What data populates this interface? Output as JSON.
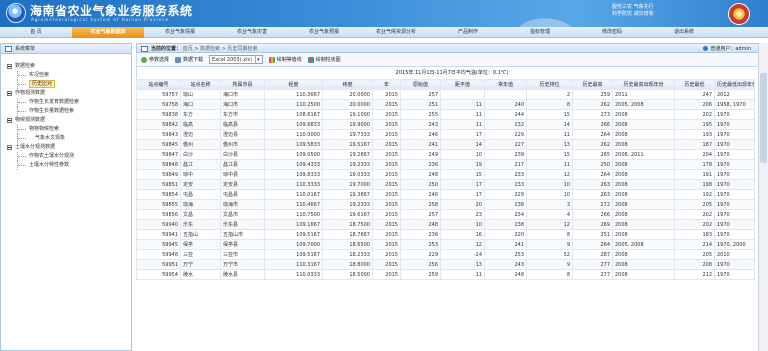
{
  "header": {
    "title": "海南省农业气象业务服务系统",
    "subtitle": "Agrometeorological System of Hainan Province",
    "slogan_line1": "服务三农 气象先行",
    "slogan_line2": "科学防灾 减灾增收"
  },
  "nav": {
    "items": [
      {
        "label": "首 页"
      },
      {
        "label": "农业气象数据库"
      },
      {
        "label": "农业气象情报"
      },
      {
        "label": "农业气象灾害"
      },
      {
        "label": "农业气象预报"
      },
      {
        "label": "农业气候资源分析"
      },
      {
        "label": "产品制作"
      },
      {
        "label": "指标管理"
      },
      {
        "label": "修改密码"
      },
      {
        "label": "退出系统"
      }
    ],
    "active_index": 1
  },
  "sidebar": {
    "title": "系统菜单",
    "tree": [
      {
        "label": "数据检索",
        "level": 0
      },
      {
        "label": "实况检索",
        "level": 1
      },
      {
        "label": "历史比对",
        "level": 1,
        "selected": true
      },
      {
        "label": "作物观测数据",
        "level": 0
      },
      {
        "label": "作物生长发育数据检索",
        "level": 1
      },
      {
        "label": "作物生长量数据检索",
        "level": 1
      },
      {
        "label": "物候观测数据",
        "level": 0
      },
      {
        "label": "物物物候检索",
        "level": 1
      },
      {
        "label": "气象水文现象",
        "level": 1,
        "deep": true
      },
      {
        "label": "土壤水分观测数据",
        "level": 0
      },
      {
        "label": "作物农土壤水分观测",
        "level": 1
      },
      {
        "label": "土壤水分特性参数",
        "level": 1
      }
    ]
  },
  "breadcrumb": {
    "label": "当前的位置：",
    "path": "首页 > 数据检索 > 历史同期检索",
    "user": "普通用户：admin"
  },
  "toolbar": {
    "params_label": "参数选择",
    "download_label": "数据下载",
    "format_value": "Excel 2003(.xls)",
    "line_chart_label": "绘制等值线",
    "bar_chart_label": "绘制柱状图"
  },
  "table": {
    "title": "2015年 11月1日-11月7日平均气温(单位：0.1℃)",
    "columns": [
      "站点编号",
      "站点名称",
      "所属市县",
      "经度",
      "纬度",
      "年",
      "原始值",
      "距平值",
      "常年值",
      "历史排位",
      "历史最高",
      "历史最高出现年份",
      "历史最低",
      "历史最低出现年份"
    ],
    "rows": [
      [
        "59757",
        "琼山",
        "海口市",
        "110.3667",
        "20.0000",
        "2015",
        "257",
        "",
        "",
        "2",
        "259",
        "2011",
        "247",
        "2012"
      ],
      [
        "59758",
        "海口",
        "海口市",
        "110.2500",
        "20.0000",
        "2015",
        "251",
        "11",
        "240",
        "8",
        "262",
        "2005, 2008",
        "206",
        "1958, 1970"
      ],
      [
        "59838",
        "东方",
        "东方市",
        "108.6167",
        "19.1000",
        "2015",
        "255",
        "11",
        "244",
        "15",
        "273",
        "2008",
        "202",
        "1970"
      ],
      [
        "59842",
        "临高",
        "临高县",
        "109.6833",
        "19.9000",
        "2015",
        "243",
        "11",
        "232",
        "14",
        "266",
        "2008",
        "195",
        "1970"
      ],
      [
        "59843",
        "澄迈",
        "澄迈县",
        "110.0000",
        "19.7333",
        "2015",
        "246",
        "17",
        "229",
        "11",
        "264",
        "2008",
        "193",
        "1970"
      ],
      [
        "59845",
        "儋州",
        "儋州市",
        "109.5833",
        "19.5167",
        "2015",
        "241",
        "14",
        "227",
        "13",
        "262",
        "2008",
        "187",
        "1970"
      ],
      [
        "59847",
        "白沙",
        "白沙县",
        "109.0500",
        "19.2667",
        "2015",
        "249",
        "10",
        "239",
        "15",
        "265",
        "2008, 2011",
        "204",
        "1970"
      ],
      [
        "59848",
        "昌江",
        "昌江县",
        "109.4333",
        "19.2333",
        "2015",
        "236",
        "19",
        "217",
        "11",
        "250",
        "2008",
        "178",
        "1970"
      ],
      [
        "59849",
        "琼中",
        "琼中县",
        "109.8333",
        "19.0333",
        "2015",
        "248",
        "15",
        "233",
        "12",
        "264",
        "2008",
        "191",
        "1970"
      ],
      [
        "59851",
        "定安",
        "定安县",
        "110.3333",
        "19.7000",
        "2015",
        "250",
        "17",
        "233",
        "10",
        "263",
        "2008",
        "198",
        "1970"
      ],
      [
        "59854",
        "屯昌",
        "屯昌县",
        "110.0167",
        "19.3667",
        "2015",
        "246",
        "17",
        "229",
        "10",
        "263",
        "2008",
        "192",
        "1970"
      ],
      [
        "59855",
        "琼海",
        "琼海市",
        "110.4667",
        "19.2333",
        "2015",
        "258",
        "20",
        "238",
        "3",
        "272",
        "2008",
        "205",
        "1970"
      ],
      [
        "59856",
        "文昌",
        "文昌市",
        "110.7500",
        "19.6167",
        "2015",
        "257",
        "23",
        "234",
        "4",
        "266",
        "2008",
        "202",
        "1970"
      ],
      [
        "59940",
        "乐东",
        "乐东县",
        "109.1667",
        "18.7500",
        "2015",
        "248",
        "10",
        "238",
        "12",
        "269",
        "2008",
        "202",
        "1970"
      ],
      [
        "59941",
        "五指山",
        "五指山市",
        "109.5167",
        "18.7667",
        "2015",
        "236",
        "16",
        "220",
        "8",
        "251",
        "2008",
        "183",
        "1970"
      ],
      [
        "59945",
        "保亭",
        "保亭县",
        "109.7000",
        "18.6500",
        "2015",
        "253",
        "12",
        "241",
        "9",
        "264",
        "2005, 2008",
        "214",
        "1970, 2000"
      ],
      [
        "59948",
        "三亚",
        "三亚市",
        "109.5167",
        "18.2333",
        "2015",
        "229",
        "-24",
        "253",
        "52",
        "287",
        "2008",
        "205",
        "2010"
      ],
      [
        "59951",
        "万宁",
        "万宁市",
        "110.3167",
        "18.8000",
        "2015",
        "256",
        "13",
        "243",
        "9",
        "277",
        "2008",
        "208",
        "1970"
      ],
      [
        "59954",
        "陵水",
        "陵水县",
        "110.0333",
        "18.5000",
        "2015",
        "259",
        "11",
        "248",
        "8",
        "277",
        "2008",
        "212",
        "1970"
      ]
    ]
  }
}
